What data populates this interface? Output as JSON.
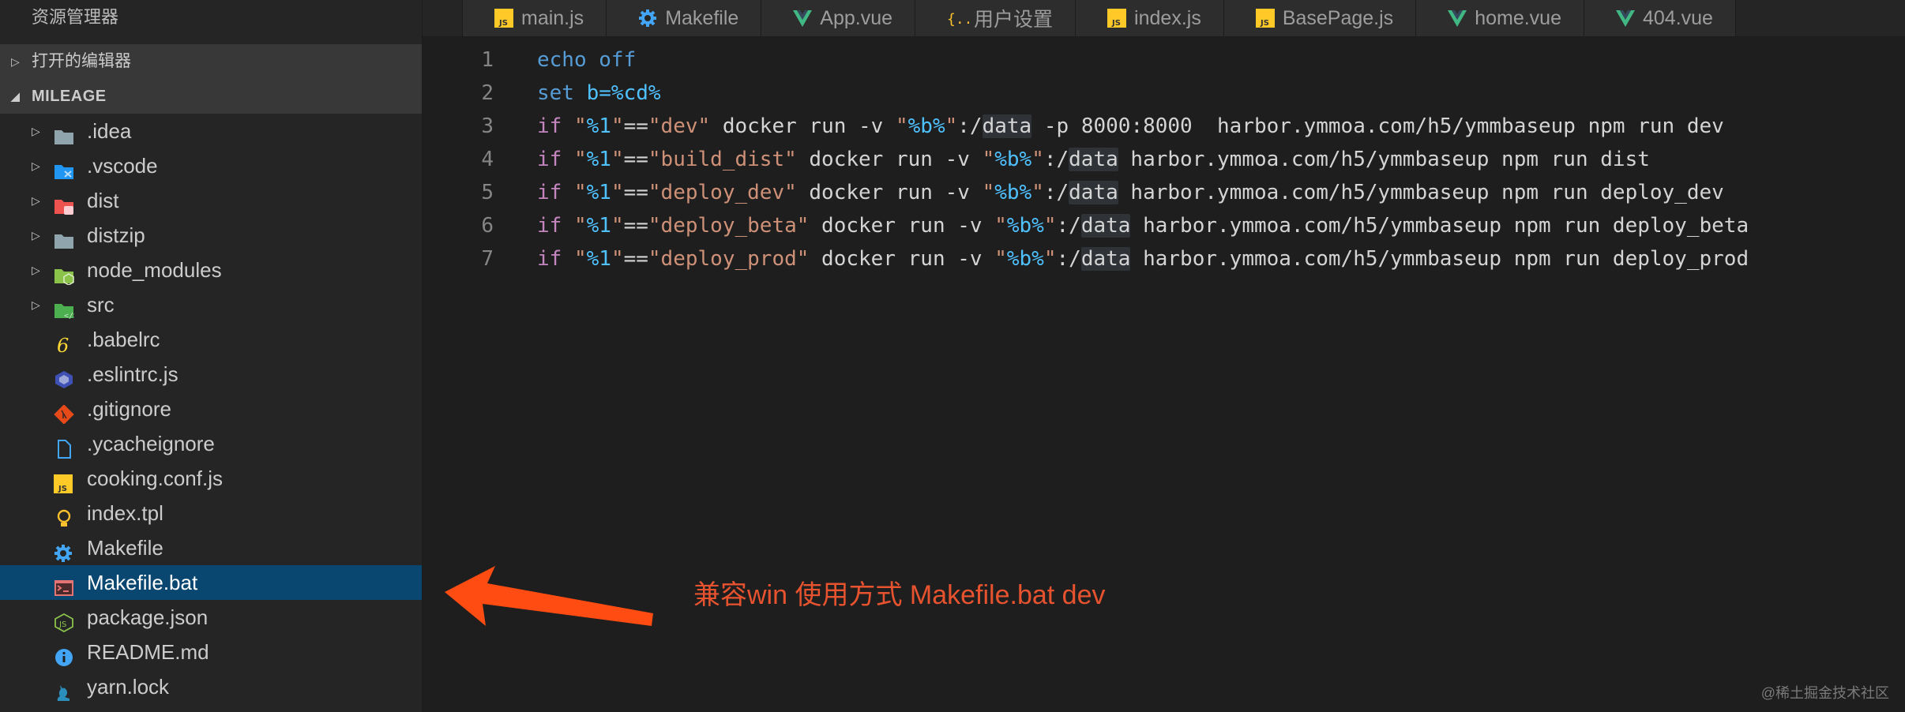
{
  "sidebar": {
    "title": "资源管理器",
    "open_editors_label": "打开的编辑器",
    "project_label": "MILEAGE",
    "items": [
      {
        "label": ".idea",
        "type": "folder",
        "icon": "folder-icon",
        "color": "#90a4ae"
      },
      {
        "label": ".vscode",
        "type": "folder",
        "icon": "vscode-folder-icon",
        "color": "#2196f3"
      },
      {
        "label": "dist",
        "type": "folder",
        "icon": "dist-folder-icon",
        "color": "#ef5350"
      },
      {
        "label": "distzip",
        "type": "folder",
        "icon": "folder-icon",
        "color": "#90a4ae"
      },
      {
        "label": "node_modules",
        "type": "folder",
        "icon": "node-folder-icon",
        "color": "#8bc34a"
      },
      {
        "label": "src",
        "type": "folder",
        "icon": "src-folder-icon",
        "color": "#4caf50"
      },
      {
        "label": ".babelrc",
        "type": "file",
        "icon": "babel-icon",
        "color": "#fdd835"
      },
      {
        "label": ".eslintrc.js",
        "type": "file",
        "icon": "eslint-icon",
        "color": "#3f51b5"
      },
      {
        "label": ".gitignore",
        "type": "file",
        "icon": "git-icon",
        "color": "#e64a19"
      },
      {
        "label": ".ycacheignore",
        "type": "file",
        "icon": "file-icon",
        "color": "#42a5f5"
      },
      {
        "label": "cooking.conf.js",
        "type": "file",
        "icon": "js-icon",
        "color": "#ffca28"
      },
      {
        "label": "index.tpl",
        "type": "file",
        "icon": "lightbulb-icon",
        "color": "#fbc02d"
      },
      {
        "label": "Makefile",
        "type": "file",
        "icon": "gear-icon",
        "color": "#42a5f5"
      },
      {
        "label": "Makefile.bat",
        "type": "file",
        "icon": "terminal-icon",
        "color": "#e57373",
        "selected": true
      },
      {
        "label": "package.json",
        "type": "file",
        "icon": "nodejs-icon",
        "color": "#8bc34a"
      },
      {
        "label": "README.md",
        "type": "file",
        "icon": "info-icon",
        "color": "#42a5f5"
      },
      {
        "label": "yarn.lock",
        "type": "file",
        "icon": "yarn-icon",
        "color": "#2c8ebb"
      }
    ]
  },
  "tabs": [
    {
      "label": "main.js",
      "icon": "js-icon"
    },
    {
      "label": "Makefile",
      "icon": "gear-icon"
    },
    {
      "label": "App.vue",
      "icon": "vue-icon"
    },
    {
      "label": "用户设置",
      "icon": "json-braces-icon"
    },
    {
      "label": "index.js",
      "icon": "js-icon"
    },
    {
      "label": "BasePage.js",
      "icon": "js-icon"
    },
    {
      "label": "home.vue",
      "icon": "vue-icon"
    },
    {
      "label": "404.vue",
      "icon": "vue-icon"
    }
  ],
  "editor": {
    "lines": [
      {
        "n": "1",
        "tokens": [
          [
            "cmd",
            "echo off"
          ]
        ]
      },
      {
        "n": "2",
        "tokens": [
          [
            "cmd",
            "set "
          ],
          [
            "var",
            "b=%cd%"
          ]
        ]
      },
      {
        "n": "3",
        "tokens": [
          [
            "kw",
            "if"
          ],
          [
            "txt",
            " "
          ],
          [
            "str",
            "\""
          ],
          [
            "var",
            "%1"
          ],
          [
            "str",
            "\""
          ],
          [
            "txt",
            "=="
          ],
          [
            "str",
            "\"dev\""
          ],
          [
            "txt",
            " docker run -v "
          ],
          [
            "str",
            "\""
          ],
          [
            "var",
            "%b%"
          ],
          [
            "str",
            "\""
          ],
          [
            "txt",
            ":/"
          ],
          [
            "hl",
            "data"
          ],
          [
            "txt",
            " -p 8000:8000  harbor.ymmoa.com/h5/ymmbaseup npm run dev"
          ]
        ]
      },
      {
        "n": "4",
        "tokens": [
          [
            "kw",
            "if"
          ],
          [
            "txt",
            " "
          ],
          [
            "str",
            "\""
          ],
          [
            "var",
            "%1"
          ],
          [
            "str",
            "\""
          ],
          [
            "txt",
            "=="
          ],
          [
            "str",
            "\"build_dist\""
          ],
          [
            "txt",
            " docker run -v "
          ],
          [
            "str",
            "\""
          ],
          [
            "var",
            "%b%"
          ],
          [
            "str",
            "\""
          ],
          [
            "txt",
            ":/"
          ],
          [
            "hl",
            "data"
          ],
          [
            "txt",
            " harbor.ymmoa.com/h5/ymmbaseup npm run dist"
          ]
        ]
      },
      {
        "n": "5",
        "tokens": [
          [
            "kw",
            "if"
          ],
          [
            "txt",
            " "
          ],
          [
            "str",
            "\""
          ],
          [
            "var",
            "%1"
          ],
          [
            "str",
            "\""
          ],
          [
            "txt",
            "=="
          ],
          [
            "str",
            "\"deploy_dev\""
          ],
          [
            "txt",
            " docker run -v "
          ],
          [
            "str",
            "\""
          ],
          [
            "var",
            "%b%"
          ],
          [
            "str",
            "\""
          ],
          [
            "txt",
            ":/"
          ],
          [
            "hl",
            "data"
          ],
          [
            "txt",
            " harbor.ymmoa.com/h5/ymmbaseup npm run deploy_dev"
          ]
        ]
      },
      {
        "n": "6",
        "tokens": [
          [
            "kw",
            "if"
          ],
          [
            "txt",
            " "
          ],
          [
            "str",
            "\""
          ],
          [
            "var",
            "%1"
          ],
          [
            "str",
            "\""
          ],
          [
            "txt",
            "=="
          ],
          [
            "str",
            "\"deploy_beta\""
          ],
          [
            "txt",
            " docker run -v "
          ],
          [
            "str",
            "\""
          ],
          [
            "var",
            "%b%"
          ],
          [
            "str",
            "\""
          ],
          [
            "txt",
            ":/"
          ],
          [
            "hl",
            "data"
          ],
          [
            "txt",
            " harbor.ymmoa.com/h5/ymmbaseup npm run deploy_beta"
          ]
        ]
      },
      {
        "n": "7",
        "tokens": [
          [
            "kw",
            "if"
          ],
          [
            "txt",
            " "
          ],
          [
            "str",
            "\""
          ],
          [
            "var",
            "%1"
          ],
          [
            "str",
            "\""
          ],
          [
            "txt",
            "=="
          ],
          [
            "str",
            "\"deploy_prod\""
          ],
          [
            "txt",
            " docker run -v "
          ],
          [
            "str",
            "\""
          ],
          [
            "var",
            "%b%"
          ],
          [
            "str",
            "\""
          ],
          [
            "txt",
            ":/"
          ],
          [
            "hl",
            "data"
          ],
          [
            "txt",
            " harbor.ymmoa.com/h5/ymmbaseup npm run deploy_prod"
          ]
        ]
      }
    ]
  },
  "annotation": {
    "text": "兼容win  使用方式   Makefile.bat dev",
    "color": "#e8532f"
  },
  "watermark": "@稀土掘金技术社区"
}
